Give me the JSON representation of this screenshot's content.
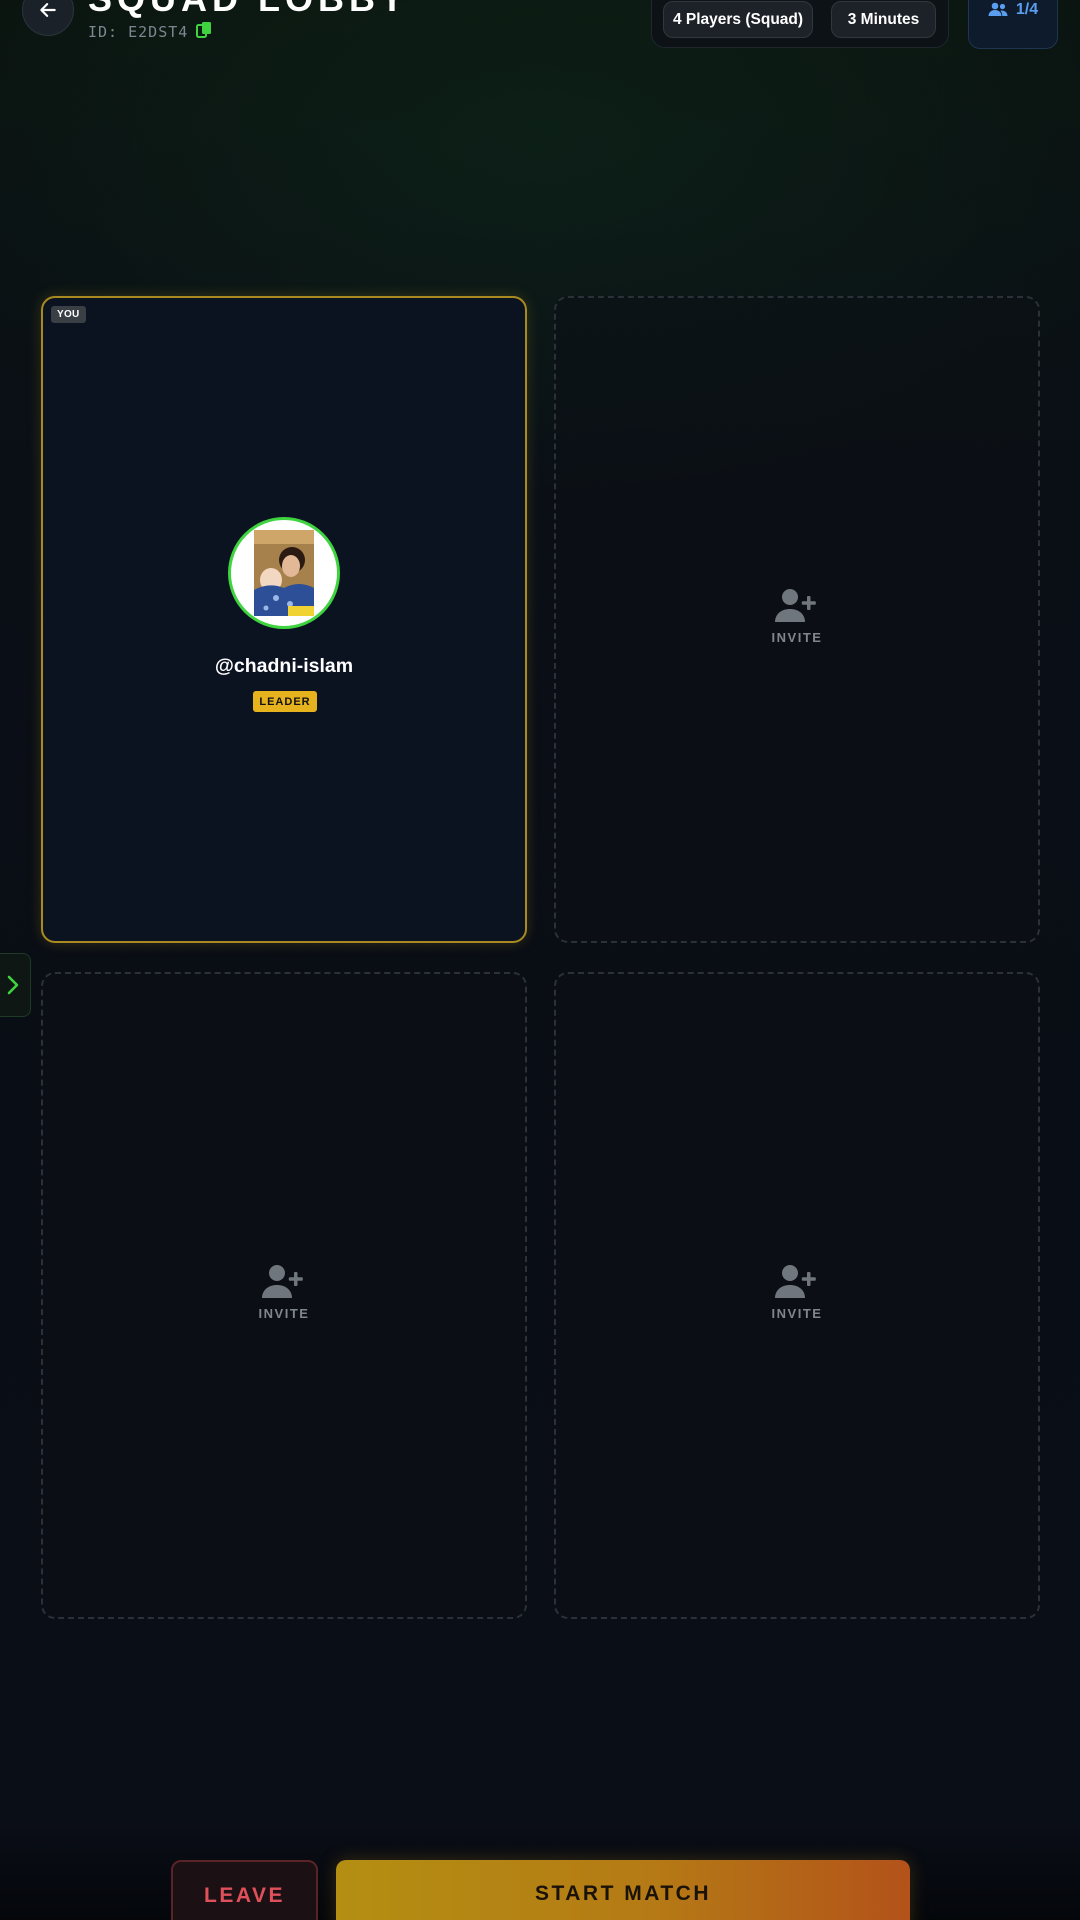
{
  "header": {
    "title": "SQUAD LOBBY",
    "lobby_id": "ID: E2DST4",
    "back_icon": "arrow-left-icon",
    "copy_icon": "copy-icon"
  },
  "settings": {
    "mode": "4 Players (Squad)",
    "duration": "3 Minutes"
  },
  "player_count": {
    "icon": "users-icon",
    "value": "1/4"
  },
  "slots": [
    {
      "status": "occupied",
      "you_badge": "YOU",
      "username": "@chadni-islam",
      "role": "LEADER",
      "avatar": "user-photo"
    },
    {
      "status": "empty",
      "label": "INVITE",
      "icon": "user-plus-icon"
    },
    {
      "status": "empty",
      "label": "INVITE",
      "icon": "user-plus-icon"
    },
    {
      "status": "empty",
      "label": "INVITE",
      "icon": "user-plus-icon"
    }
  ],
  "side_panel": {
    "icon": "chevron-right-icon"
  },
  "footer": {
    "leave_label": "LEAVE",
    "start_label": "START MATCH"
  },
  "colors": {
    "accent_green": "#3fd43f",
    "leader_gold": "#e6b31e",
    "player_blue": "#5b9ef0",
    "leave_red": "#e0505a"
  }
}
